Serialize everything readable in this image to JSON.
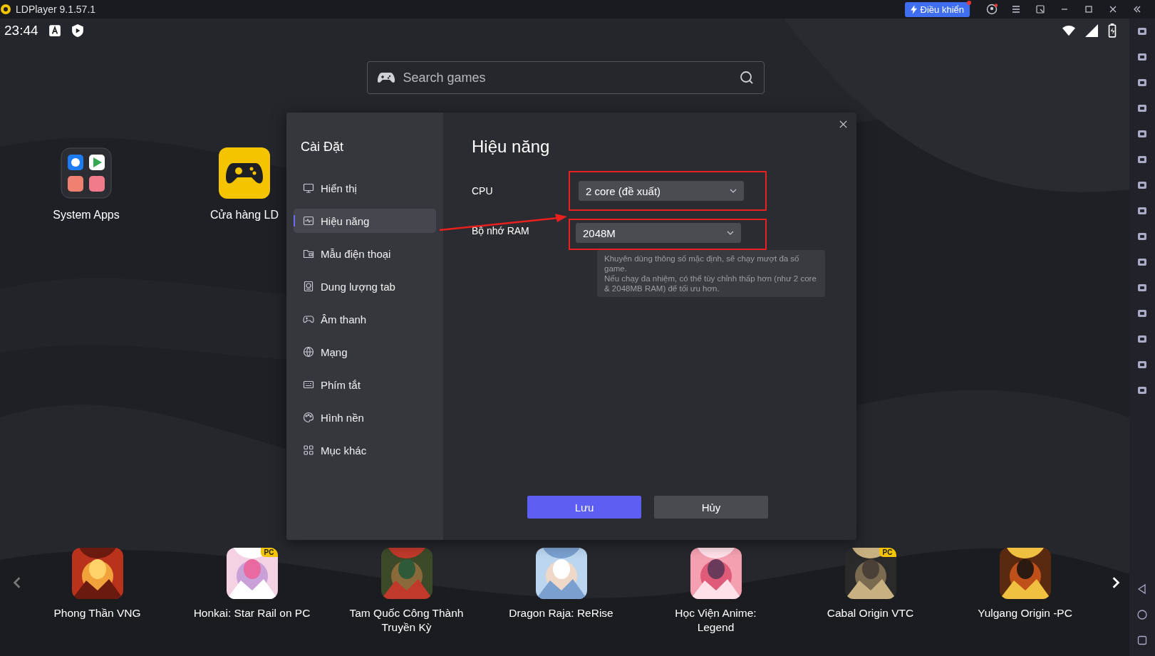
{
  "window": {
    "title": "LDPlayer 9.1.57.1",
    "control_button": {
      "label": "Điều khiển"
    }
  },
  "status_bar": {
    "time": "23:44"
  },
  "search": {
    "placeholder": "Search games"
  },
  "desktop_apps": [
    {
      "label": "System Apps"
    },
    {
      "label": "Cửa hàng LD"
    }
  ],
  "settings_dialog": {
    "title": "Cài Đặt",
    "nav": [
      {
        "label": "Hiển thị",
        "selected": false
      },
      {
        "label": "Hiệu năng",
        "selected": true
      },
      {
        "label": "Mẫu điện thoại",
        "selected": false
      },
      {
        "label": "Dung lượng tab",
        "selected": false
      },
      {
        "label": "Âm thanh",
        "selected": false
      },
      {
        "label": "Mạng",
        "selected": false
      },
      {
        "label": "Phím tắt",
        "selected": false
      },
      {
        "label": "Hình nền",
        "selected": false
      },
      {
        "label": "Mục khác",
        "selected": false
      }
    ],
    "section_title": "Hiệu năng",
    "fields": [
      {
        "label": "CPU",
        "value": "2 core (đề xuất)"
      },
      {
        "label": "Bộ nhớ RAM",
        "value": "2048M"
      }
    ],
    "hint": [
      "Khuyên dùng thông số mặc định, sẽ chạy mượt đa số game.",
      "Nếu chạy đa nhiệm, có thể tùy chỉnh thấp hơn (như 2 core & 2048MB RAM) để tối ưu hơn."
    ],
    "buttons": [
      {
        "label": "Lưu",
        "kind": "primary"
      },
      {
        "label": "Hủy",
        "kind": "secondary"
      }
    ]
  },
  "games": [
    {
      "name": "Phong Thần VNG"
    },
    {
      "name": "Honkai: Star Rail on PC",
      "badge": "PC"
    },
    {
      "name": "Tam Quốc Công Thành Truyền Kỳ"
    },
    {
      "name": "Dragon Raja: ReRise"
    },
    {
      "name": "Học Viện Anime: Legend"
    },
    {
      "name": "Cabal Origin VTC",
      "badge": "PC"
    },
    {
      "name": "Yulgang Origin -PC"
    }
  ]
}
